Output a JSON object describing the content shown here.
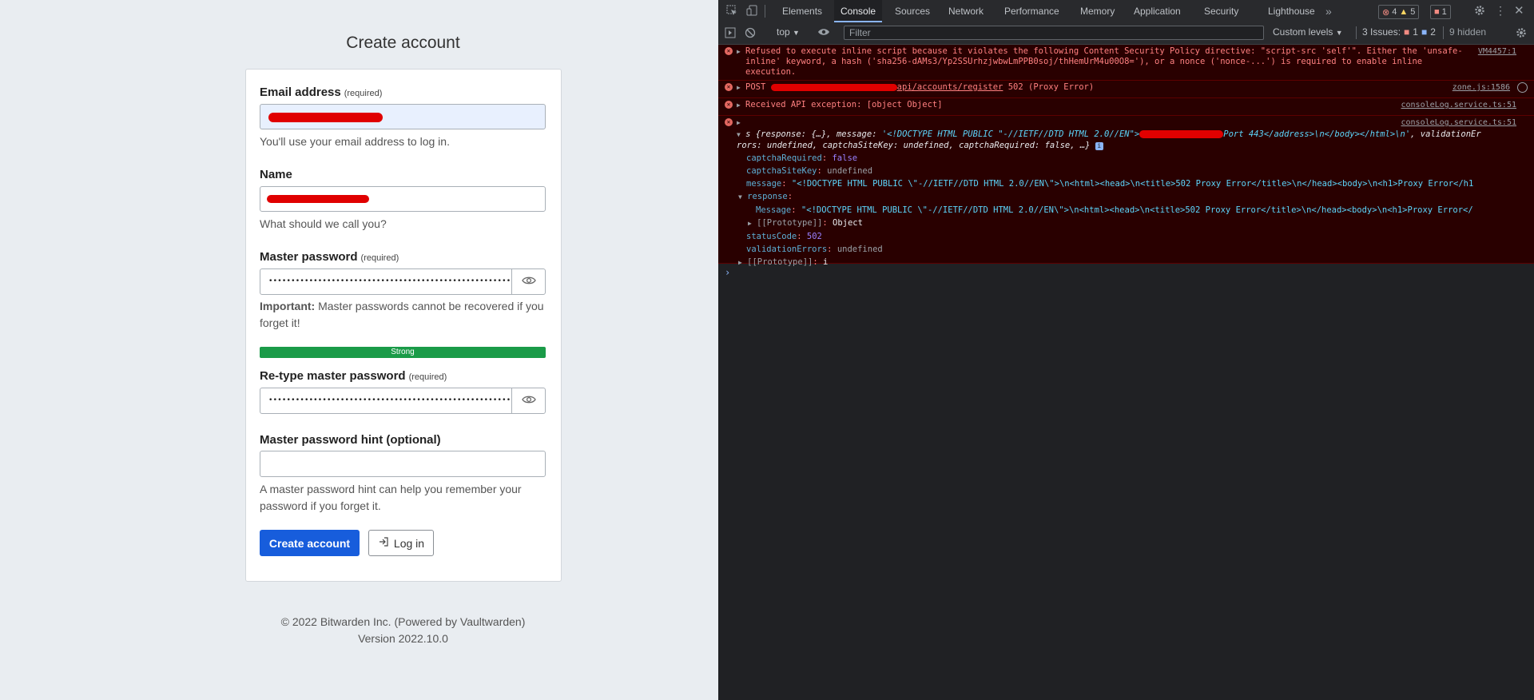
{
  "page": {
    "title": "Create account",
    "email_label": "Email address",
    "required": "(required)",
    "email_help": "You'll use your email address to log in.",
    "name_label": "Name",
    "name_help": "What should we call you?",
    "master_label": "Master password",
    "master_dots": "•••••••••••••••••••••••••••••••••••••••••••••••••••••••••••••••••••••••••••••••",
    "important_strong": "Important:",
    "important_text": " Master passwords cannot be recovered if you forget it!",
    "strength": "Strong",
    "strength_value": 1.0,
    "retype_label": "Re-type master password",
    "retype_dots": "•••••••••••••••••••••••••••••••••••••••••••••••••••••••••••••••••••••••••••••••",
    "hint_label": "Master password hint (optional)",
    "hint_help": "A master password hint can help you remember your password if you forget it.",
    "create_button": "Create account",
    "login_button": "Log in",
    "footer_copyright": "© 2022 Bitwarden Inc. (Powered by Vaultwarden)",
    "footer_version": "Version 2022.10.0"
  },
  "devtools": {
    "tabs": [
      "Elements",
      "Console",
      "Sources",
      "Network",
      "Performance",
      "Memory",
      "Application",
      "Security",
      "Lighthouse"
    ],
    "active_tab": "Console",
    "error_count": "4",
    "warning_count": "5",
    "issue_count": "1",
    "context": "top",
    "filter_placeholder": "Filter",
    "levels": "Custom levels",
    "issues_label": "3 Issues:",
    "issues_err": "1",
    "issues_info": "2",
    "hidden": "9 hidden",
    "messages": [
      {
        "text": "Refused to execute inline script because it violates the following Content Security Policy directive: \"script-src 'self'\". Either the 'unsafe-inline' keyword, a hash ('sha256-dAMs3/Yp2SSUrhzjwbwLmPPB0soj/thHemUrM4u00O8='), or a nonce ('nonce-...') is required to enable inline execution.",
        "source": "VM4457:1"
      },
      {
        "method": "POST",
        "url": "api/accounts/register",
        "status": "502 (Proxy Error)",
        "source": "zone.js:1586"
      },
      {
        "text": "Received API exception: [object Object]",
        "source": "consoleLog.service.ts:51"
      },
      {
        "source": "consoleLog.service.ts:51",
        "summary_a": "s {response: {…}, message: ",
        "summary_b": "'<!DOCTYPE HTML PUBLIC \"-//IETF//DTD HTML 2.0//EN\">",
        "summary_c": "Port 443</address>\\n</body></html>\\n'",
        "summary_d": ", validationEr",
        "summary_e": "rors: undefined, captchaSiteKey: undefined, captchaRequired: false, …}",
        "props": [
          {
            "k": "captchaRequired",
            "v": "false"
          },
          {
            "k": "captchaSiteKey",
            "v": "undefined"
          },
          {
            "k": "message",
            "v": "\"<!DOCTYPE HTML PUBLIC \\\"-//IETF//DTD HTML 2.0//EN\\\">\\n<html><head>\\n<title>502 Proxy Error</title>\\n</head><body>\\n<h1>Proxy Error</h1"
          },
          {
            "k": "response",
            "v": ""
          },
          {
            "k": "Message",
            "v": "\"<!DOCTYPE HTML PUBLIC \\\"-//IETF//DTD HTML 2.0//EN\\\">\\n<html><head>\\n<title>502 Proxy Error</title>\\n</head><body>\\n<h1>Proxy Error</"
          },
          {
            "k": "[[Prototype]]",
            "v": "Object"
          },
          {
            "k": "statusCode",
            "v": "502"
          },
          {
            "k": "validationErrors",
            "v": "undefined"
          },
          {
            "k": "[[Prototype]]",
            "v": "i"
          }
        ]
      }
    ]
  }
}
